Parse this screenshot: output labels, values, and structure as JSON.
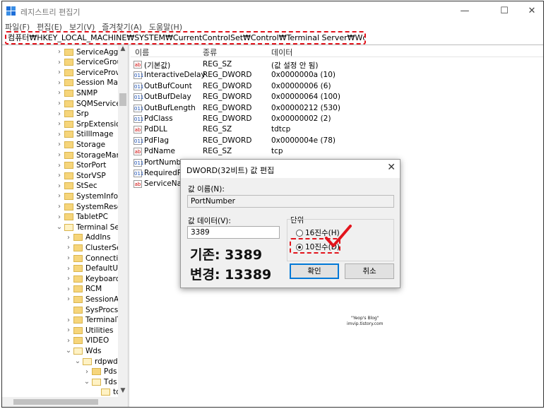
{
  "window": {
    "title": "레지스트리 편집기",
    "buttons": {
      "minimize": "—",
      "maximize": "☐",
      "close": "✕"
    }
  },
  "menu": [
    "파일(F)",
    "편집(E)",
    "보기(V)",
    "즐겨찾기(A)",
    "도움말(H)"
  ],
  "address": "컴퓨터₩HKEY_LOCAL_MACHINE₩SYSTEM₩CurrentControlSet₩Control₩Terminal Server₩Wds₩rdpwd₩Tds₩tcp",
  "tree": [
    {
      "label": "ServiceAggreg",
      "indent": 0,
      "chev": "›"
    },
    {
      "label": "ServiceGroupC",
      "indent": 0,
      "chev": "›"
    },
    {
      "label": "ServiceProvide",
      "indent": 0,
      "chev": "›"
    },
    {
      "label": "Session Mana",
      "indent": 0,
      "chev": "›"
    },
    {
      "label": "SNMP",
      "indent": 0,
      "chev": "›"
    },
    {
      "label": "SQMServiceLi",
      "indent": 0,
      "chev": "›"
    },
    {
      "label": "Srp",
      "indent": 0,
      "chev": "›"
    },
    {
      "label": "SrpExtensionC",
      "indent": 0,
      "chev": "›"
    },
    {
      "label": "StillImage",
      "indent": 0,
      "chev": "›"
    },
    {
      "label": "Storage",
      "indent": 0,
      "chev": "›"
    },
    {
      "label": "StorageManag",
      "indent": 0,
      "chev": "›"
    },
    {
      "label": "StorPort",
      "indent": 0,
      "chev": "›"
    },
    {
      "label": "StorVSP",
      "indent": 0,
      "chev": "›"
    },
    {
      "label": "StSec",
      "indent": 0,
      "chev": "›"
    },
    {
      "label": "SystemInform",
      "indent": 0,
      "chev": "›"
    },
    {
      "label": "SystemResour",
      "indent": 0,
      "chev": "›"
    },
    {
      "label": "TabletPC",
      "indent": 0,
      "chev": "›"
    },
    {
      "label": "Terminal Serve",
      "indent": 0,
      "chev": "⌄",
      "open": true
    },
    {
      "label": "AddIns",
      "indent": 1,
      "chev": "›"
    },
    {
      "label": "ClusterSett",
      "indent": 1,
      "chev": "›"
    },
    {
      "label": "Connection",
      "indent": 1,
      "chev": "›"
    },
    {
      "label": "DefaultUse",
      "indent": 1,
      "chev": "›"
    },
    {
      "label": "KeyboardTy",
      "indent": 1,
      "chev": "›"
    },
    {
      "label": "RCM",
      "indent": 1,
      "chev": "›"
    },
    {
      "label": "SessionArb",
      "indent": 1,
      "chev": "›"
    },
    {
      "label": "SysProcs",
      "indent": 1,
      "chev": ""
    },
    {
      "label": "TerminalTy",
      "indent": 1,
      "chev": "›"
    },
    {
      "label": "Utilities",
      "indent": 1,
      "chev": "›"
    },
    {
      "label": "VIDEO",
      "indent": 1,
      "chev": "›"
    },
    {
      "label": "Wds",
      "indent": 1,
      "chev": "⌄",
      "open": true
    },
    {
      "label": "rdpwd",
      "indent": 2,
      "chev": "⌄",
      "open": true
    },
    {
      "label": "Pds",
      "indent": 3,
      "chev": "›"
    },
    {
      "label": "Tds",
      "indent": 3,
      "chev": "⌄",
      "open": true
    },
    {
      "label": "tc",
      "indent": 4,
      "chev": "",
      "open": true
    }
  ],
  "columns": {
    "name": "이름",
    "type": "종류",
    "data": "데이터"
  },
  "values": [
    {
      "name": "(기본값)",
      "type": "REG_SZ",
      "data": "(값 설정 안 됨)",
      "icon": "ab"
    },
    {
      "name": "InteractiveDelay",
      "type": "REG_DWORD",
      "data": "0x0000000a (10)",
      "icon": "bin"
    },
    {
      "name": "OutBufCount",
      "type": "REG_DWORD",
      "data": "0x00000006 (6)",
      "icon": "bin"
    },
    {
      "name": "OutBufDelay",
      "type": "REG_DWORD",
      "data": "0x00000064 (100)",
      "icon": "bin"
    },
    {
      "name": "OutBufLength",
      "type": "REG_DWORD",
      "data": "0x00000212 (530)",
      "icon": "bin"
    },
    {
      "name": "PdClass",
      "type": "REG_DWORD",
      "data": "0x00000002 (2)",
      "icon": "bin"
    },
    {
      "name": "PdDLL",
      "type": "REG_SZ",
      "data": "tdtcp",
      "icon": "ab"
    },
    {
      "name": "PdFlag",
      "type": "REG_DWORD",
      "data": "0x0000004e (78)",
      "icon": "bin"
    },
    {
      "name": "PdName",
      "type": "REG_SZ",
      "data": "tcp",
      "icon": "ab"
    },
    {
      "name": "PortNumber",
      "type": "",
      "data": "",
      "icon": "bin"
    },
    {
      "name": "RequiredPds",
      "type": "",
      "data": "",
      "icon": "bin"
    },
    {
      "name": "ServiceName",
      "type": "",
      "data": "",
      "icon": "ab"
    }
  ],
  "dialog": {
    "title": "DWORD(32비트) 값 편집",
    "name_label": "값 이름(N):",
    "name_value": "PortNumber",
    "data_label": "값 데이터(V):",
    "data_value": "3389",
    "base_label": "단위",
    "hex_label": "16진수(H)",
    "dec_label": "10진수(D)",
    "ok": "확인",
    "cancel": "취소"
  },
  "annotations": {
    "before": "기존: 3389",
    "after": "변경: 13389"
  },
  "watermark": {
    "line1": "\"Yeop's Blog\"",
    "line2": "imvip.tistory.com"
  },
  "colors": {
    "annotation_red": "#e2141c",
    "selection_blue": "#0078d7"
  }
}
